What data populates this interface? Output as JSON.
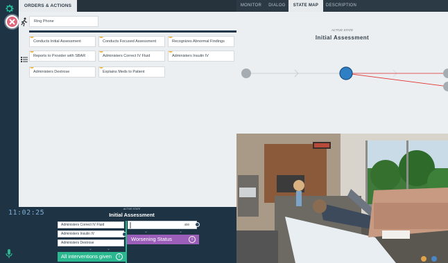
{
  "tabs_left": {
    "orders_actions": "ORDERS & ACTIONS"
  },
  "tabs_right": [
    {
      "label": "MONITOR",
      "active": false
    },
    {
      "label": "DIALOG",
      "active": false
    },
    {
      "label": "STATE MAP",
      "active": true
    },
    {
      "label": "DESCRIPTION",
      "active": false
    }
  ],
  "orders": {
    "ring_phone": "Ring Phone",
    "actions": [
      "Conducts Initial Assessment",
      "Conducts Focused Assessment",
      "Recognizes Abnormal Findings",
      "Reports to Provider with SBAR",
      "Administers Correct IV Fluid",
      "Administers Insulin IV",
      "Administers Dextrose",
      "Explains Meds to Patient"
    ]
  },
  "status": {
    "timer": "11:02:25",
    "active_state_label": "ACTIVE STATE",
    "active_state": "Initial Assessment",
    "interventions": [
      "Administers Correct IV Fluid",
      "Administers Insulin IV",
      "Administers Dextrose"
    ],
    "trend_value": "400",
    "worsening_label": "Worsening Status",
    "all_interventions_label": "All interventions given",
    "info_glyph": "i"
  },
  "state_map": {
    "active_state_label": "ACTIVE STATE",
    "active_state": "Initial Assessment"
  },
  "colors": {
    "rail": "#1e3344",
    "accent_green": "#2bb890",
    "accent_purple": "#9b5fba",
    "active_node": "#2e7fc4",
    "transition_red": "#e03030",
    "action_dot": "#f2b63a",
    "close_button": "#e0677b"
  },
  "icons": {
    "settings": "gear-icon",
    "close": "close-icon",
    "ring_phone": "running-person-icon",
    "actions": "checklist-icon",
    "microphone": "microphone-icon",
    "info": "info-icon"
  }
}
